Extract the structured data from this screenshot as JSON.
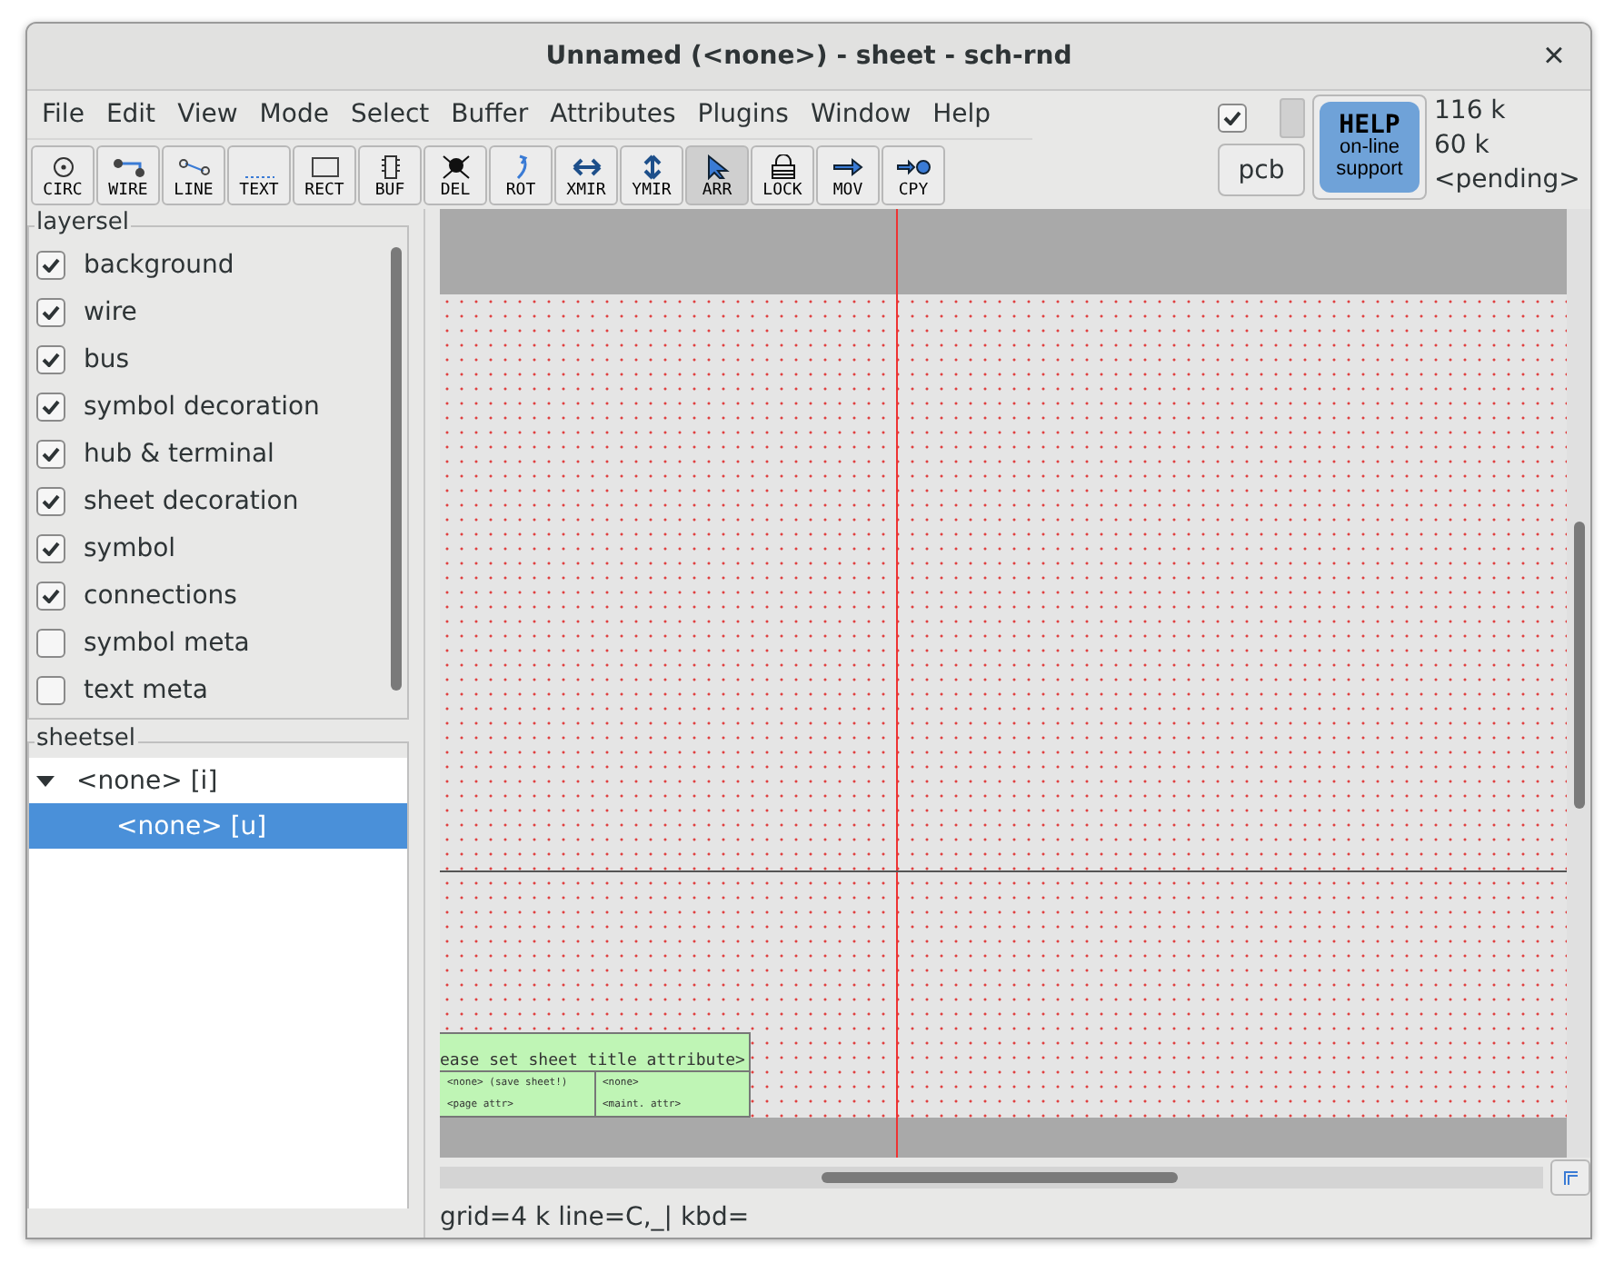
{
  "window": {
    "title": "Unnamed (<none>) - sheet - sch-rnd",
    "close": "×"
  },
  "menu": [
    "File",
    "Edit",
    "View",
    "Mode",
    "Select",
    "Buffer",
    "Attributes",
    "Plugins",
    "Window",
    "Help"
  ],
  "toolbar": [
    {
      "label": "CIRC",
      "selected": false
    },
    {
      "label": "WIRE",
      "selected": false
    },
    {
      "label": "LINE",
      "selected": false
    },
    {
      "label": "TEXT",
      "selected": false
    },
    {
      "label": "RECT",
      "selected": false
    },
    {
      "label": "BUF",
      "selected": false
    },
    {
      "label": "DEL",
      "selected": false
    },
    {
      "label": "ROT",
      "selected": false
    },
    {
      "label": "XMIR",
      "selected": false
    },
    {
      "label": "YMIR",
      "selected": false
    },
    {
      "label": "ARR",
      "selected": true
    },
    {
      "label": "LOCK",
      "selected": false
    },
    {
      "label": "MOV",
      "selected": false
    },
    {
      "label": "CPY",
      "selected": false
    }
  ],
  "top_right": {
    "checked": true,
    "pcb_button": "pcb",
    "help": [
      "HELP",
      "on-line",
      "support"
    ],
    "stats": [
      "116 k",
      "60 k",
      "<pending>"
    ]
  },
  "layersel": {
    "title": "layersel",
    "items": [
      {
        "label": "background",
        "checked": true
      },
      {
        "label": "wire",
        "checked": true
      },
      {
        "label": "bus",
        "checked": true
      },
      {
        "label": "symbol decoration",
        "checked": true
      },
      {
        "label": "hub & terminal",
        "checked": true
      },
      {
        "label": "sheet decoration",
        "checked": true
      },
      {
        "label": "symbol",
        "checked": true
      },
      {
        "label": "connections",
        "checked": true
      },
      {
        "label": "symbol meta",
        "checked": false
      },
      {
        "label": "text meta",
        "checked": false
      }
    ]
  },
  "sheetsel": {
    "title": "sheetsel",
    "tree": [
      {
        "label": "<none> [i]",
        "expanded": true,
        "selected": false,
        "children": [
          {
            "label": "<none> [u]",
            "selected": true
          }
        ]
      }
    ]
  },
  "title_block": {
    "title": "ease set sheet title attribute>",
    "cells": [
      "<none> (save sheet!)",
      "<page attr>",
      "<none>",
      "<maint. attr>"
    ]
  },
  "status_bar": "grid=4 k line=C,_| kbd="
}
